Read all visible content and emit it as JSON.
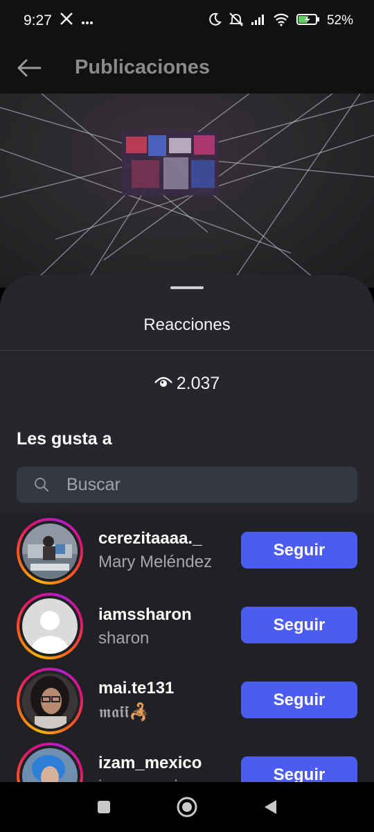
{
  "status_bar": {
    "time": "9:27",
    "left_icons": [
      "x-logo-icon",
      "more-dots-icon"
    ],
    "right_icons": [
      "moon-icon",
      "mute-icon",
      "signal-icon",
      "wifi-icon",
      "battery-icon"
    ],
    "battery": "52%",
    "battery_level": 0.52
  },
  "header": {
    "title": "Publicaciones",
    "back_icon": "arrow-left-icon"
  },
  "sheet": {
    "title": "Reacciones",
    "views_icon": "eye-icon",
    "views_count": "2.037",
    "section_title": "Les gusta a",
    "search": {
      "placeholder": "Buscar",
      "value": ""
    }
  },
  "likers": [
    {
      "username": "cerezitaaaa._",
      "full_name": "Mary Meléndez",
      "button": "Seguir",
      "avatar": "photo"
    },
    {
      "username": "iamssharon",
      "full_name": "sharon",
      "button": "Seguir",
      "avatar": "default-avatar-icon"
    },
    {
      "username": "mai.te131",
      "full_name": "𝖒𝖆𝖎́𝖎́🦂",
      "button": "Seguir",
      "avatar": "photo"
    },
    {
      "username": "izam_mexico",
      "full_name": "izam_mexico",
      "button": "Seguir",
      "avatar": "photo"
    }
  ],
  "colors": {
    "follow_button": "#4c5cf0",
    "sheet_bg": "#25272c",
    "list_bg": "#1f2125"
  },
  "nav_bar": {
    "icons": [
      "recents-square-icon",
      "home-circle-icon",
      "back-triangle-icon"
    ]
  }
}
